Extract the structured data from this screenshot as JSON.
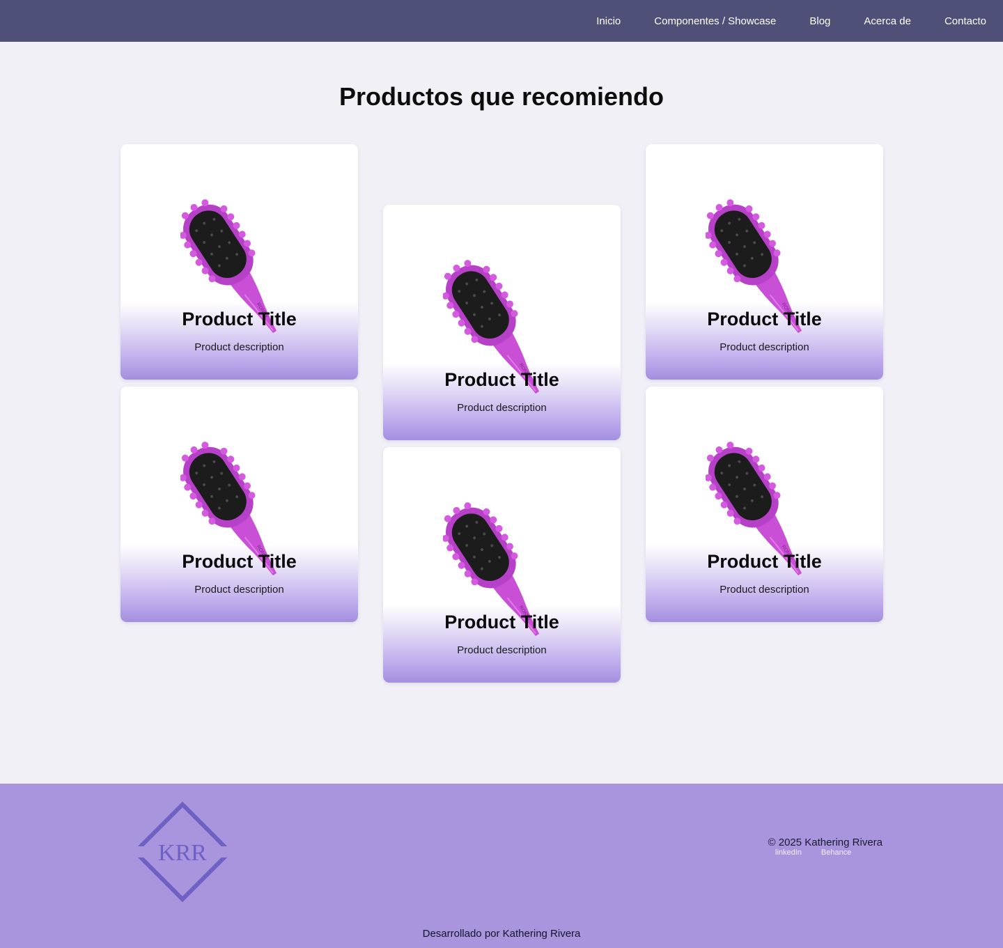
{
  "nav": {
    "items": [
      {
        "label": "Inicio"
      },
      {
        "label": "Componentes / Showcase"
      },
      {
        "label": "Blog"
      },
      {
        "label": "Acerca de"
      },
      {
        "label": "Contacto"
      }
    ]
  },
  "main": {
    "title": "Productos que recomiendo",
    "cards": [
      {
        "title": "Product Title",
        "description": "Product description",
        "image_icon": "hairbrush-image"
      },
      {
        "title": "Product Title",
        "description": "Product description",
        "image_icon": "hairbrush-image"
      },
      {
        "title": "Product Title",
        "description": "Product description",
        "image_icon": "hairbrush-image"
      },
      {
        "title": "Product Title",
        "description": "Product description",
        "image_icon": "hairbrush-image"
      },
      {
        "title": "Product Title",
        "description": "Product description",
        "image_icon": "hairbrush-image"
      },
      {
        "title": "Product Title",
        "description": "Product description",
        "image_icon": "hairbrush-image"
      }
    ]
  },
  "footer": {
    "logo_text": "KRR",
    "copyright": "© 2025 Kathering Rivera",
    "links": [
      {
        "label": "linkedIn"
      },
      {
        "label": "Behance"
      }
    ],
    "credit": "Desarrollado por Kathering Rivera"
  },
  "colors": {
    "nav_bg": "#4e5078",
    "page_bg": "#f2f0f7",
    "footer_bg": "#a994de",
    "logo_color": "#6f60c4",
    "brush_pink": "#c94fd6",
    "card_gradient_end": "#a48fe0"
  }
}
